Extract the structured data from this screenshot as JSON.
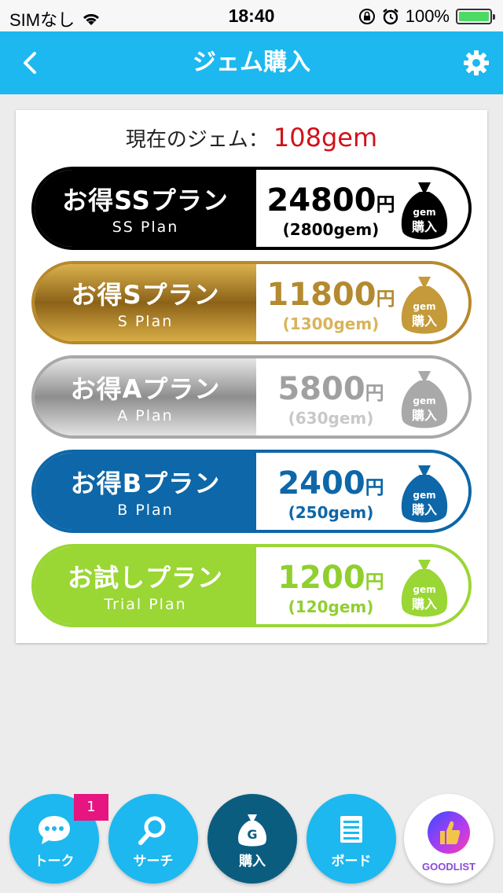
{
  "status": {
    "carrier": "SIMなし",
    "time": "18:40",
    "battery": "100%",
    "battery_level": 1.0
  },
  "nav": {
    "title": "ジェム購入",
    "back_icon": "chevron-left-icon",
    "settings_icon": "gear-icon"
  },
  "balance": {
    "label": "現在のジェム：",
    "value": "108gem"
  },
  "plans": [
    {
      "name": "お得SSプラン",
      "sub": "SS Plan",
      "price": "24800",
      "yen": "円",
      "gems": "(2800gem)",
      "bag_top": "gem",
      "bag_bottom": "購入",
      "color": "#000000"
    },
    {
      "name": "お得Sプラン",
      "sub": "S Plan",
      "price": "11800",
      "yen": "円",
      "gems": "(1300gem)",
      "bag_top": "gem",
      "bag_bottom": "購入",
      "color": "#b8892b"
    },
    {
      "name": "お得Aプラン",
      "sub": "A Plan",
      "price": "5800",
      "yen": "円",
      "gems": "(630gem)",
      "bag_top": "gem",
      "bag_bottom": "購入",
      "color": "#a8a8a8"
    },
    {
      "name": "お得Bプラン",
      "sub": "B Plan",
      "price": "2400",
      "yen": "円",
      "gems": "(250gem)",
      "bag_top": "gem",
      "bag_bottom": "購入",
      "color": "#0d67a8"
    },
    {
      "name": "お試しプラン",
      "sub": "Trial Plan",
      "price": "1200",
      "yen": "円",
      "gems": "(120gem)",
      "bag_top": "gem",
      "bag_bottom": "購入",
      "color": "#9ad634"
    }
  ],
  "tabs": [
    {
      "label": "トーク",
      "icon": "chat-bubble-icon",
      "badge": "1"
    },
    {
      "label": "サーチ",
      "icon": "search-icon"
    },
    {
      "label": "購入",
      "icon": "gem-bag-icon",
      "glyph": "G"
    },
    {
      "label": "ボード",
      "icon": "board-icon"
    },
    {
      "label": "GOODLIST",
      "icon": "thumbs-up-icon"
    }
  ],
  "colors": {
    "accent": "#1cb8ef",
    "active_tab": "#0b5d80",
    "balance_value": "#d0121b",
    "badge": "#e6157f"
  }
}
